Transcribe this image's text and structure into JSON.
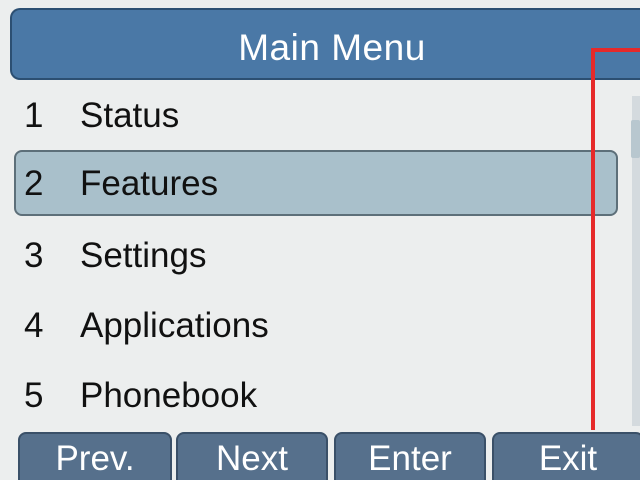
{
  "header": {
    "title": "Main  Menu"
  },
  "menu": {
    "items": [
      {
        "number": "1",
        "label": "Status"
      },
      {
        "number": "2",
        "label": "Features"
      },
      {
        "number": "3",
        "label": "Settings"
      },
      {
        "number": "4",
        "label": "Applications"
      },
      {
        "number": "5",
        "label": "Phonebook"
      }
    ],
    "selected_index": 1
  },
  "softkeys": {
    "prev": "Prev.",
    "next": "Next",
    "enter": "Enter",
    "exit": "Exit"
  },
  "colors": {
    "header_bg": "#4a78a6",
    "selected_bg": "#a9c0cb",
    "softkey_bg": "#56708c",
    "highlight_annotation": "#e62a2a"
  }
}
